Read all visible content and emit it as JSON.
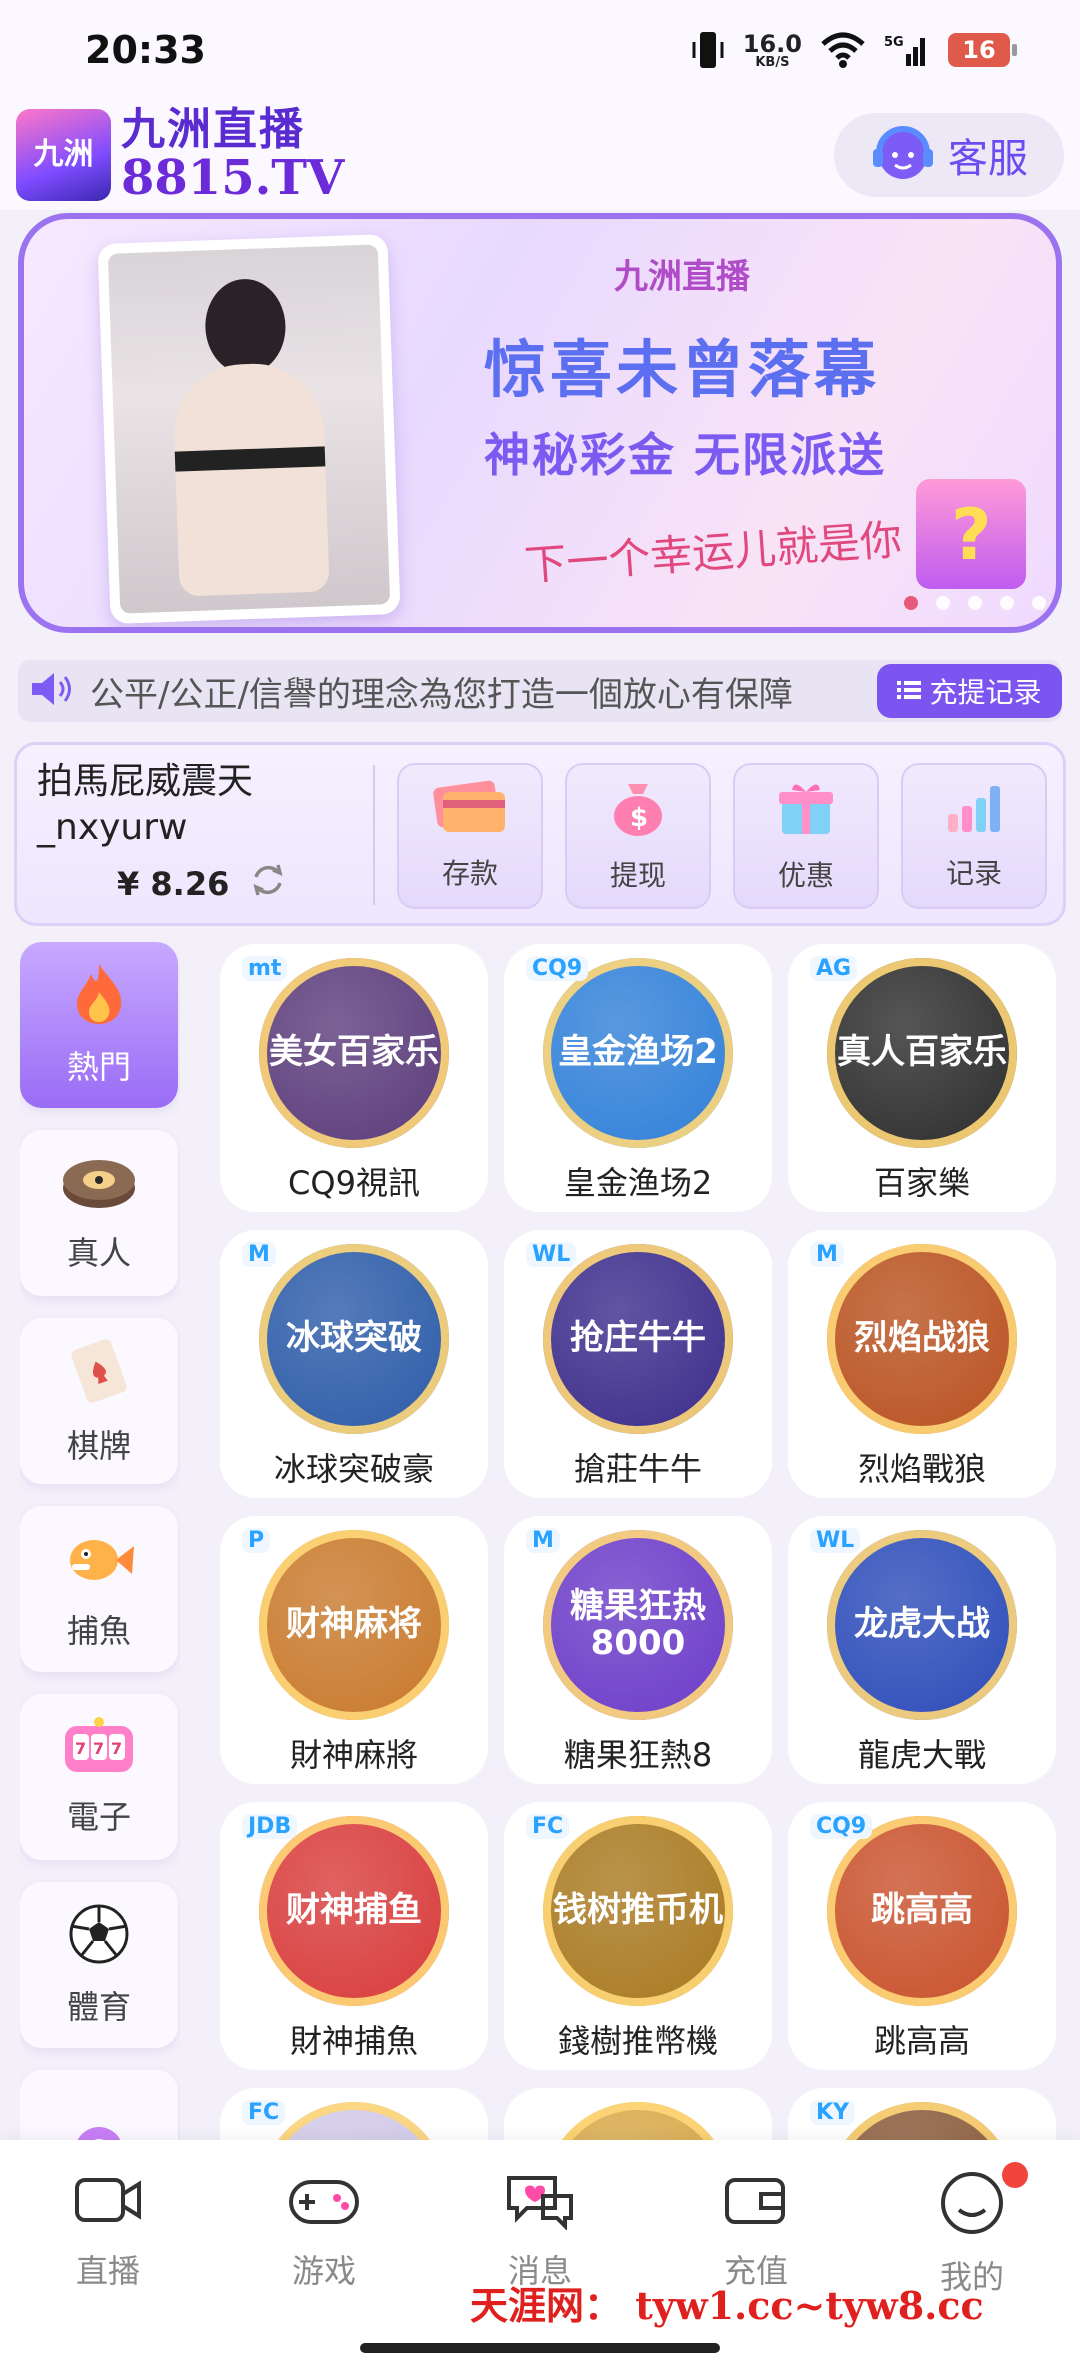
{
  "status_bar": {
    "time": "20:33",
    "net_speed": "16.0",
    "net_unit": "KB/S",
    "network": "5G",
    "battery": "16"
  },
  "header": {
    "logo_badge": "九洲",
    "logo_cn": "九洲直播",
    "logo_url": "8815.TV",
    "cs_label": "客服"
  },
  "banner": {
    "tag": "九洲直播",
    "title": "惊喜未曾落幕",
    "subtitle": "神秘彩金 无限派送",
    "line": "下一个幸运儿就是你"
  },
  "marquee": {
    "text": "公平/公正/信譽的理念為您打造一個放心有保障",
    "record_label": "充提记录"
  },
  "account": {
    "username": "拍馬屁威震天_nxyurw",
    "balance": "¥ 8.26",
    "actions": [
      {
        "label": "存款",
        "icon": "card-icon"
      },
      {
        "label": "提现",
        "icon": "money-bag-icon"
      },
      {
        "label": "优惠",
        "icon": "gift-icon"
      },
      {
        "label": "记录",
        "icon": "bar-chart-icon"
      }
    ]
  },
  "sidebar": {
    "items": [
      {
        "label": "熱門"
      },
      {
        "label": "真人"
      },
      {
        "label": "棋牌"
      },
      {
        "label": "捕魚"
      },
      {
        "label": "電子"
      },
      {
        "label": "體育"
      }
    ]
  },
  "games": [
    {
      "name": "CQ9視訊",
      "provider": "mt",
      "art": "美女百家乐",
      "color": "#5a3a7a"
    },
    {
      "name": "皇金渔场2",
      "provider": "CQ9",
      "art": "皇金渔场2",
      "color": "#2f7fd8"
    },
    {
      "name": "百家樂",
      "provider": "AG",
      "art": "真人百家乐",
      "color": "#2b2b2b"
    },
    {
      "name": "冰球突破豪",
      "provider": "M",
      "art": "冰球突破",
      "color": "#2a5aa8"
    },
    {
      "name": "搶莊牛牛",
      "provider": "WL",
      "art": "抢庄牛牛",
      "color": "#3a2a8a"
    },
    {
      "name": "烈焰戰狼",
      "provider": "M",
      "art": "烈焰战狼",
      "color": "#b8501e"
    },
    {
      "name": "財神麻將",
      "provider": "P",
      "art": "财神麻将",
      "color": "#c8782a"
    },
    {
      "name": "糖果狂熱8",
      "provider": "M",
      "art": "糖果狂热8000",
      "color": "#6a3ac8"
    },
    {
      "name": "龍虎大戰",
      "provider": "WL",
      "art": "龙虎大战",
      "color": "#2a4ab8"
    },
    {
      "name": "財神捕魚",
      "provider": "JDB",
      "art": "财神捕鱼",
      "color": "#d83a3a"
    },
    {
      "name": "錢樹推幣機",
      "provider": "FC",
      "art": "钱树推币机",
      "color": "#a8781e"
    },
    {
      "name": "跳高高",
      "provider": "CQ9",
      "art": "跳高高",
      "color": "#c8502a"
    },
    {
      "name": "",
      "provider": "FC",
      "art": "",
      "color": "#d0c8e8"
    },
    {
      "name": "",
      "provider": "",
      "art": "",
      "color": "#d8a848"
    },
    {
      "name": "",
      "provider": "KY",
      "art": "",
      "color": "#8a5a3a"
    }
  ],
  "bottom_nav": {
    "items": [
      {
        "label": "直播"
      },
      {
        "label": "游戏"
      },
      {
        "label": "消息"
      },
      {
        "label": "充值"
      },
      {
        "label": "我的"
      }
    ]
  },
  "watermark": "天涯网： tyw1.cc~tyw8.cc",
  "colors": {
    "accent": "#7c55f0",
    "brand": "#5a2bd0",
    "badge": "#f0443d"
  }
}
